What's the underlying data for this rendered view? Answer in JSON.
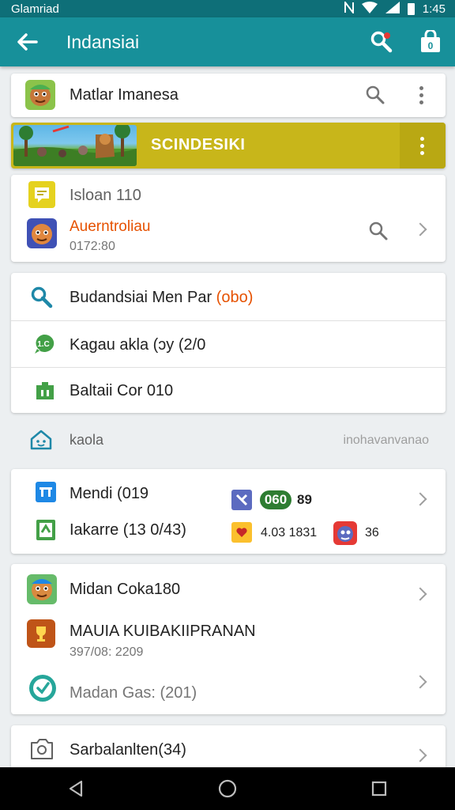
{
  "status_bar": {
    "carrier": "Glamriad",
    "time": "1:45"
  },
  "app_bar": {
    "title": "Indansiai"
  },
  "header_card": {
    "title": "Matlar Imanesa"
  },
  "banner": {
    "text": "SCINDESIKI"
  },
  "card1": {
    "row1_label": "Isloan 110",
    "row2_title": "Auerntroliau",
    "row2_sub": "0172:80"
  },
  "card2": {
    "items": [
      {
        "label": "Budandsiai Men Par ",
        "accent": "(obo)"
      },
      {
        "label": "Kagau akla (ɔy (2/0"
      },
      {
        "label": "Baltaii Cor 010"
      }
    ]
  },
  "section": {
    "label": "kaola",
    "right": "inohavanvanao"
  },
  "card3": {
    "row1_label": "Mendi  (019",
    "row1_badge": "060",
    "row1_value": "89",
    "row2_label": "Iakarre (13 0/43)",
    "row2_value": "4.03 1831",
    "row2_count": "36"
  },
  "card4": {
    "row1_label": "Midan Coka180",
    "row2_title": "MAUIA KUIBAKIIPRANAN",
    "row2_sub": "397/08: 2209",
    "row3_label": "Madan Gas: (201)"
  },
  "card5": {
    "label": "Sarbalanlten(34)"
  },
  "colors": {
    "primary": "#17909a",
    "status": "#0e6f78",
    "banner": "#c8b61a",
    "accent": "#e65100"
  }
}
